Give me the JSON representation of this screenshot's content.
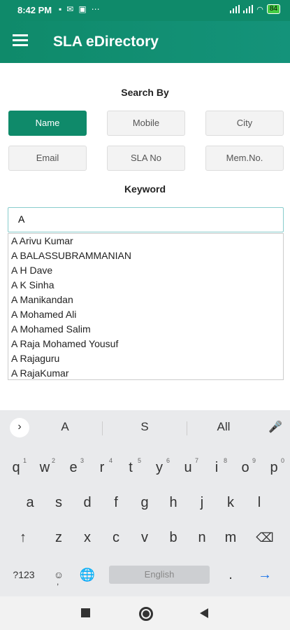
{
  "status": {
    "time": "8:42 PM",
    "left_icons": [
      "▪",
      "✉",
      "▣",
      "⋯"
    ],
    "battery": "84"
  },
  "appbar": {
    "title": "SLA eDirectory"
  },
  "search_by": {
    "label": "Search By",
    "buttons": [
      {
        "label": "Name",
        "active": true
      },
      {
        "label": "Mobile",
        "active": false
      },
      {
        "label": "City",
        "active": false
      },
      {
        "label": "Email",
        "active": false
      },
      {
        "label": "SLA No",
        "active": false
      },
      {
        "label": "Mem.No.",
        "active": false
      }
    ]
  },
  "keyword": {
    "label": "Keyword",
    "value": "A"
  },
  "results": [
    "A Arivu Kumar",
    "A BALASSUBRAMMANIAN",
    "A H Dave",
    "A K Sinha",
    "A Manikandan",
    "A Mohamed Ali",
    "A Mohamed Salim",
    "A Raja Mohamed Yousuf",
    "A Rajaguru",
    "A RajaKumar"
  ],
  "keyboard": {
    "suggestions": [
      "A",
      "S",
      "All"
    ],
    "row1": [
      [
        "q",
        "1"
      ],
      [
        "w",
        "2"
      ],
      [
        "e",
        "3"
      ],
      [
        "r",
        "4"
      ],
      [
        "t",
        "5"
      ],
      [
        "y",
        "6"
      ],
      [
        "u",
        "7"
      ],
      [
        "i",
        "8"
      ],
      [
        "o",
        "9"
      ],
      [
        "p",
        "0"
      ]
    ],
    "row2": [
      "a",
      "s",
      "d",
      "f",
      "g",
      "h",
      "j",
      "k",
      "l"
    ],
    "row3": [
      "z",
      "x",
      "c",
      "v",
      "b",
      "n",
      "m"
    ],
    "numbers_key": "?123",
    "space_label": "English",
    "period_key": ".",
    "enter_key": "→",
    "shift_key": "↑",
    "backspace_key": "⌫",
    "emoji_key": "☺",
    "emoji_sub": ",",
    "globe_key": "🌐",
    "mic_key": "🎤"
  },
  "colors": {
    "accent": "#0f8a6a"
  }
}
